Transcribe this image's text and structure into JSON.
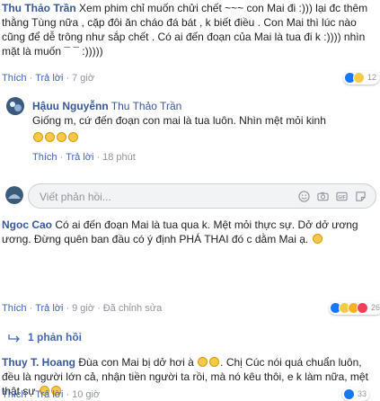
{
  "comments": [
    {
      "author": "Thu Thảo Trần",
      "text": "Xem phim chỉ muốn chửi chết ~~~ con Mai đi :))) lại đc thêm thằng Tùng nữa , cặp đôi ăn cháo đá bát , k biết điều . Con Mai thì lúc nào cũng để dễ trông như sắp chết . Có ai đến đoạn của Mai là tua đi k :))))  nhìn mặt là muốn ¯ ¯ :)))))",
      "actions": {
        "like": "Thích",
        "reply": "Trả lời",
        "time": "7 giờ"
      },
      "reactions": {
        "count": "12"
      }
    },
    {
      "author": "Hậuu Nguyễnn",
      "mention": "Thu Thảo Trần",
      "text": "Giống m, cứ đến đoạn con mai là tua luôn. Nhìn mệt mỏi kinh",
      "actions": {
        "like": "Thích",
        "reply": "Trả lời",
        "time": "18 phút"
      }
    },
    {
      "author": "Ngoc Cao",
      "text": "Có ai đến đoạn Mai là tua qua k. Mệt mỏi thực sự. Dở dở ương ương. Đừng quên ban đầu có ý định PHÁ THAI đó c dằm Mai ạ.",
      "actions": {
        "like": "Thích",
        "reply": "Trả lời",
        "time": "9 giờ",
        "edited": "Đã chỉnh sửa"
      },
      "reactions": {
        "count": "26"
      }
    },
    {
      "author": "Thuy T. Hoang",
      "text_a": "Đùa con Mai bị dở hơi à",
      "text_b": ". Chị Cúc nói quá chuẩn luôn, đều là người lớn cả, nhận tiền người ta rồi, mà nó kêu thôi, e k làm nữa, mệt thật sự",
      "actions": {
        "like": "Thích",
        "reply": "Trả lời",
        "time": "10 giờ"
      },
      "reactions": {
        "count": "33"
      }
    }
  ],
  "reply_box": {
    "placeholder": "Viết phản hồi..."
  },
  "more_replies": "1 phản hồi",
  "colors": {
    "author": "#385898",
    "link": "#4267b2",
    "meta": "#90949c",
    "like_blue": "#1877f2",
    "love_red": "#f33e58",
    "haha_yellow": "#f7c948"
  },
  "icons": [
    "like-icon",
    "love-icon",
    "haha-icon",
    "wow-icon",
    "camera-icon",
    "smile-icon",
    "gif-icon",
    "sticker-icon",
    "reply-arrow-icon"
  ]
}
